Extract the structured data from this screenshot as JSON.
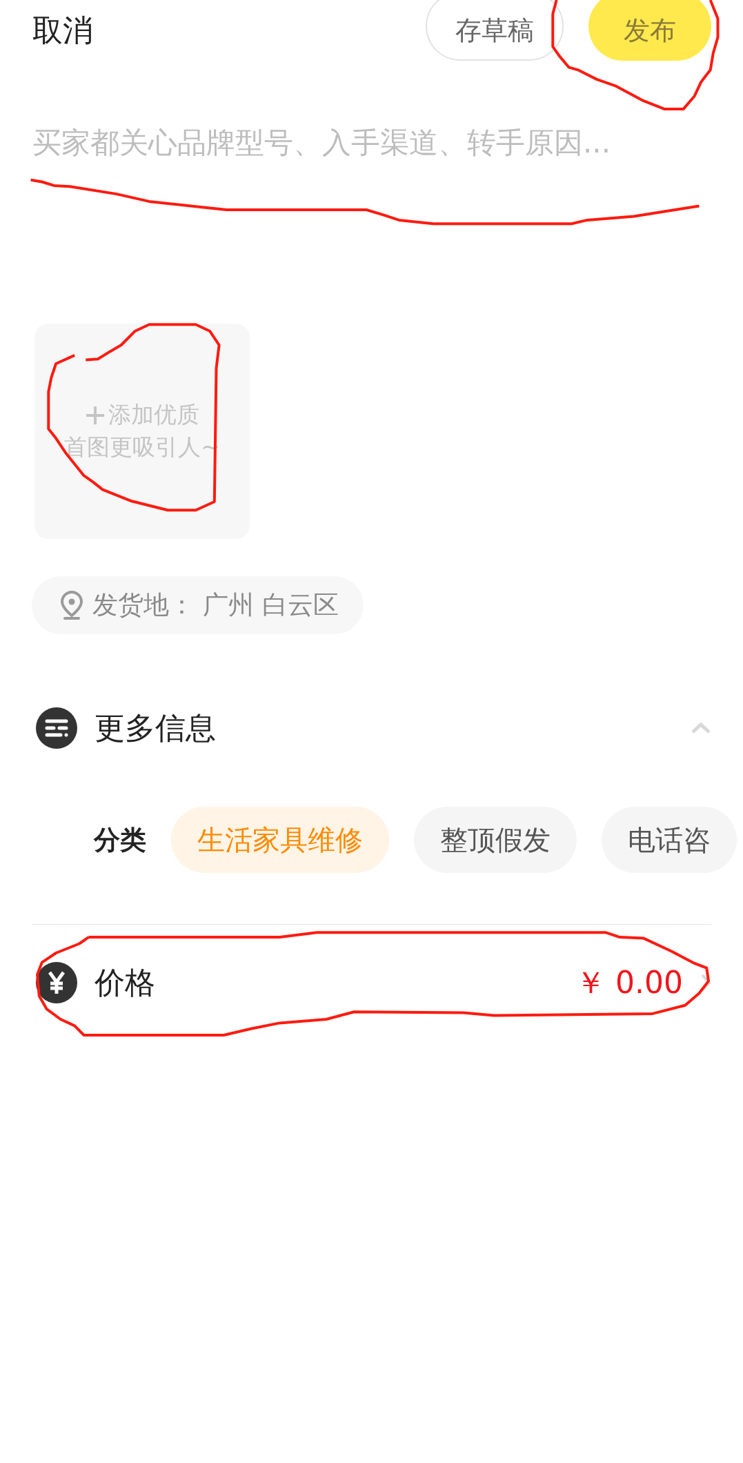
{
  "header": {
    "cancel": "取消",
    "buttons": [
      {
        "label": "存草稿",
        "kind": "outline"
      },
      {
        "label": "发布",
        "kind": "primary"
      }
    ]
  },
  "description": {
    "placeholder": "买家都关心品牌型号、入手渠道、转手原因..."
  },
  "upload": {
    "lines": [
      "添加优质",
      "首图更吸引人~"
    ]
  },
  "location": {
    "label": "发货地：",
    "value": "广州 白云区"
  },
  "more_info": {
    "title": "更多信息",
    "expanded": true
  },
  "category": {
    "label": "分类",
    "chips": [
      {
        "label": "生活家具维修",
        "selected": true
      },
      {
        "label": "整顶假发",
        "selected": false
      },
      {
        "label": "电话咨",
        "selected": false
      }
    ]
  },
  "price": {
    "label": "价格",
    "value": "￥ 0.00"
  }
}
